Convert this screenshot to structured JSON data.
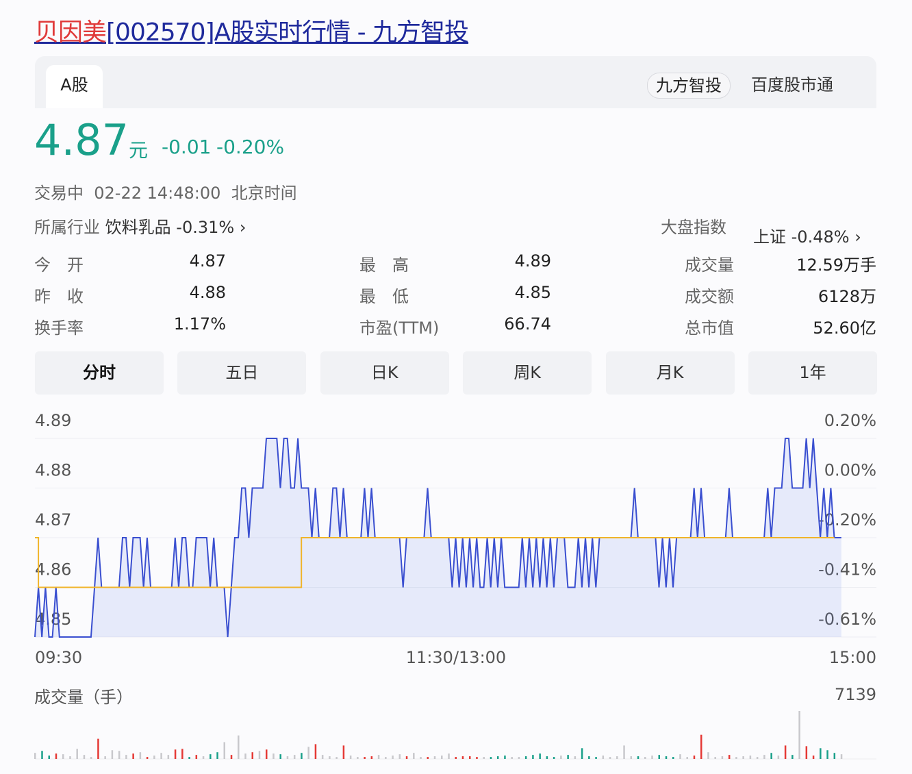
{
  "title": {
    "name": "贝因美",
    "rest": "[002570]A股实时行情 - 九方智投"
  },
  "tabs": {
    "active": "A股",
    "sources": [
      "九方智投",
      "百度股市通"
    ]
  },
  "quote": {
    "price": "4.87",
    "unit": "元",
    "change": "-0.01",
    "change_pct": "-0.20%"
  },
  "status": {
    "state": "交易中",
    "datetime": "02-22 14:48:00",
    "tz": "北京时间"
  },
  "industry": {
    "label": "所属行业",
    "name": "饮料乳品",
    "pct": "-0.31%",
    "arrow": "›"
  },
  "index": {
    "label": "大盘指数",
    "name": "上证",
    "pct": "-0.48%",
    "arrow": "›"
  },
  "stats": [
    {
      "label": "今　开",
      "value": "4.87",
      "color": "teal"
    },
    {
      "label": "最　高",
      "value": "4.89",
      "color": "red"
    },
    {
      "label": "成交量",
      "value": "12.59万手",
      "color": "plain"
    },
    {
      "label": "昨　收",
      "value": "4.88",
      "color": "plain"
    },
    {
      "label": "最　低",
      "value": "4.85",
      "color": "teal"
    },
    {
      "label": "成交额",
      "value": "6128万",
      "color": "plain"
    },
    {
      "label": "换手率",
      "value": "1.17%",
      "color": "plain"
    },
    {
      "label": "市盈(TTM)",
      "value": "66.74",
      "color": "plain"
    },
    {
      "label": "总市值",
      "value": "52.60亿",
      "color": "plain"
    }
  ],
  "periods": [
    "分时",
    "五日",
    "日K",
    "周K",
    "月K",
    "1年"
  ],
  "colors": {
    "teal": "#1aa08a",
    "red": "#e53935",
    "line": "#3a4fd0",
    "avg": "#f0b429"
  },
  "chart_data": {
    "type": "line",
    "y_left_ticks": [
      "4.89",
      "4.88",
      "4.87",
      "4.86",
      "4.85"
    ],
    "y_right_ticks": [
      "0.20%",
      "0.00%",
      "-0.20%",
      "-0.41%",
      "-0.61%"
    ],
    "x_ticks": [
      "09:30",
      "11:30/13:00",
      "15:00"
    ],
    "ylim": [
      4.85,
      4.89
    ],
    "total_minutes": 240,
    "price_ticks_from_4_85_per_minute": "0101001000000000012111111221222121111111212211222212111012233233334444344334333232222332322222323222222221222222322222212121212112121211111212121212122211121212122222222223222222121212222232322222223222222222232333443333434323232 22",
    "avg_line": [
      {
        "minute": 0,
        "price": 4.87
      },
      {
        "minute": 1,
        "price": 4.86
      },
      {
        "minute": 75,
        "price": 4.86
      },
      {
        "minute": 76,
        "price": 4.87
      },
      {
        "minute": 228,
        "price": 4.87
      }
    ],
    "volume_label": "成交量（手）",
    "volume_max": "7139",
    "volume_every_2min": [
      900,
      1200,
      500,
      800,
      700,
      400,
      1500,
      600,
      300,
      3000,
      400,
      1300,
      1200,
      600,
      800,
      1000,
      300,
      500,
      900,
      600,
      1400,
      1500,
      300,
      600,
      400,
      700,
      1000,
      2500,
      600,
      3500,
      800,
      1000,
      1200,
      1400,
      800,
      700,
      400,
      600,
      900,
      1800,
      2200,
      600,
      400,
      300,
      2000,
      500,
      300,
      300,
      400,
      600,
      300,
      500,
      700,
      400,
      900,
      300,
      300,
      400,
      500,
      800,
      300,
      400,
      400,
      300,
      300,
      300,
      400,
      500,
      300,
      300,
      400,
      600,
      800,
      400,
      300,
      500,
      600,
      400,
      1600,
      400,
      300,
      500,
      300,
      400,
      2000,
      400,
      400,
      300,
      500,
      600,
      400,
      300,
      700,
      300,
      500,
      3600,
      1000,
      300,
      400,
      600,
      300,
      400,
      500,
      300,
      600,
      900,
      500,
      2000,
      600,
      7139,
      1900,
      500,
      1600,
      1300,
      900,
      700,
      1500,
      1700,
      800,
      1000,
      600
    ]
  }
}
